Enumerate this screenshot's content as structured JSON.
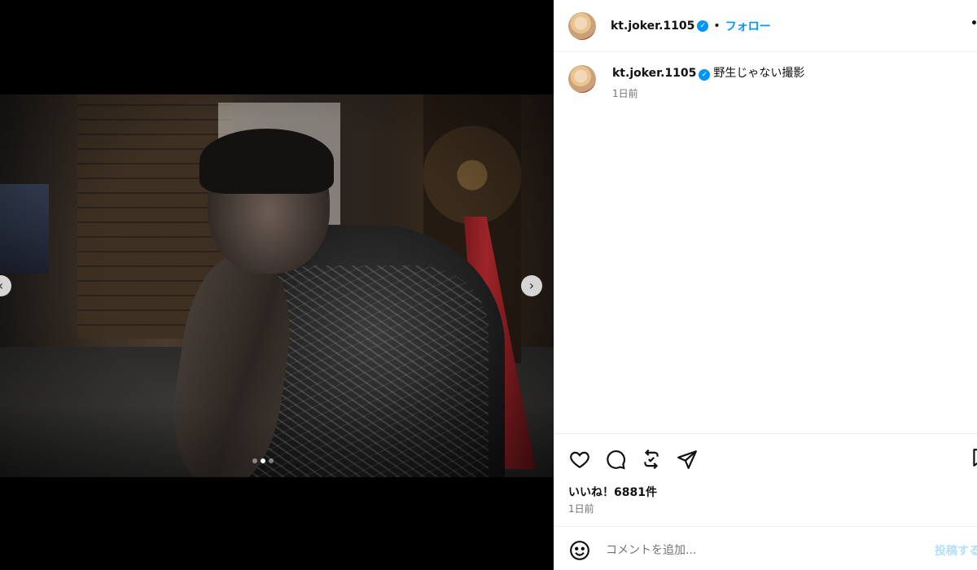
{
  "post": {
    "username": "kt.joker.1105",
    "separator": "•",
    "follow_label": "フォロー",
    "more_label": "•",
    "caption": "野生じゃない撮影",
    "caption_time": "1日前",
    "likes_text": "いいね！6881件",
    "posted_time": "1日前"
  },
  "media": {
    "nav_prev_icon": "‹",
    "nav_next_icon": "›",
    "slide_count": 3,
    "active_slide": 2
  },
  "comment": {
    "placeholder": "コメントを追加...",
    "post_label": "投稿する"
  },
  "colors": {
    "accent": "#0095f6",
    "muted": "#737373",
    "post_disabled": "#b2dffc"
  },
  "icons": [
    "heart-icon",
    "comment-icon",
    "repost-icon",
    "share-icon",
    "bookmark-icon",
    "emoji-icon",
    "verified-icon"
  ]
}
